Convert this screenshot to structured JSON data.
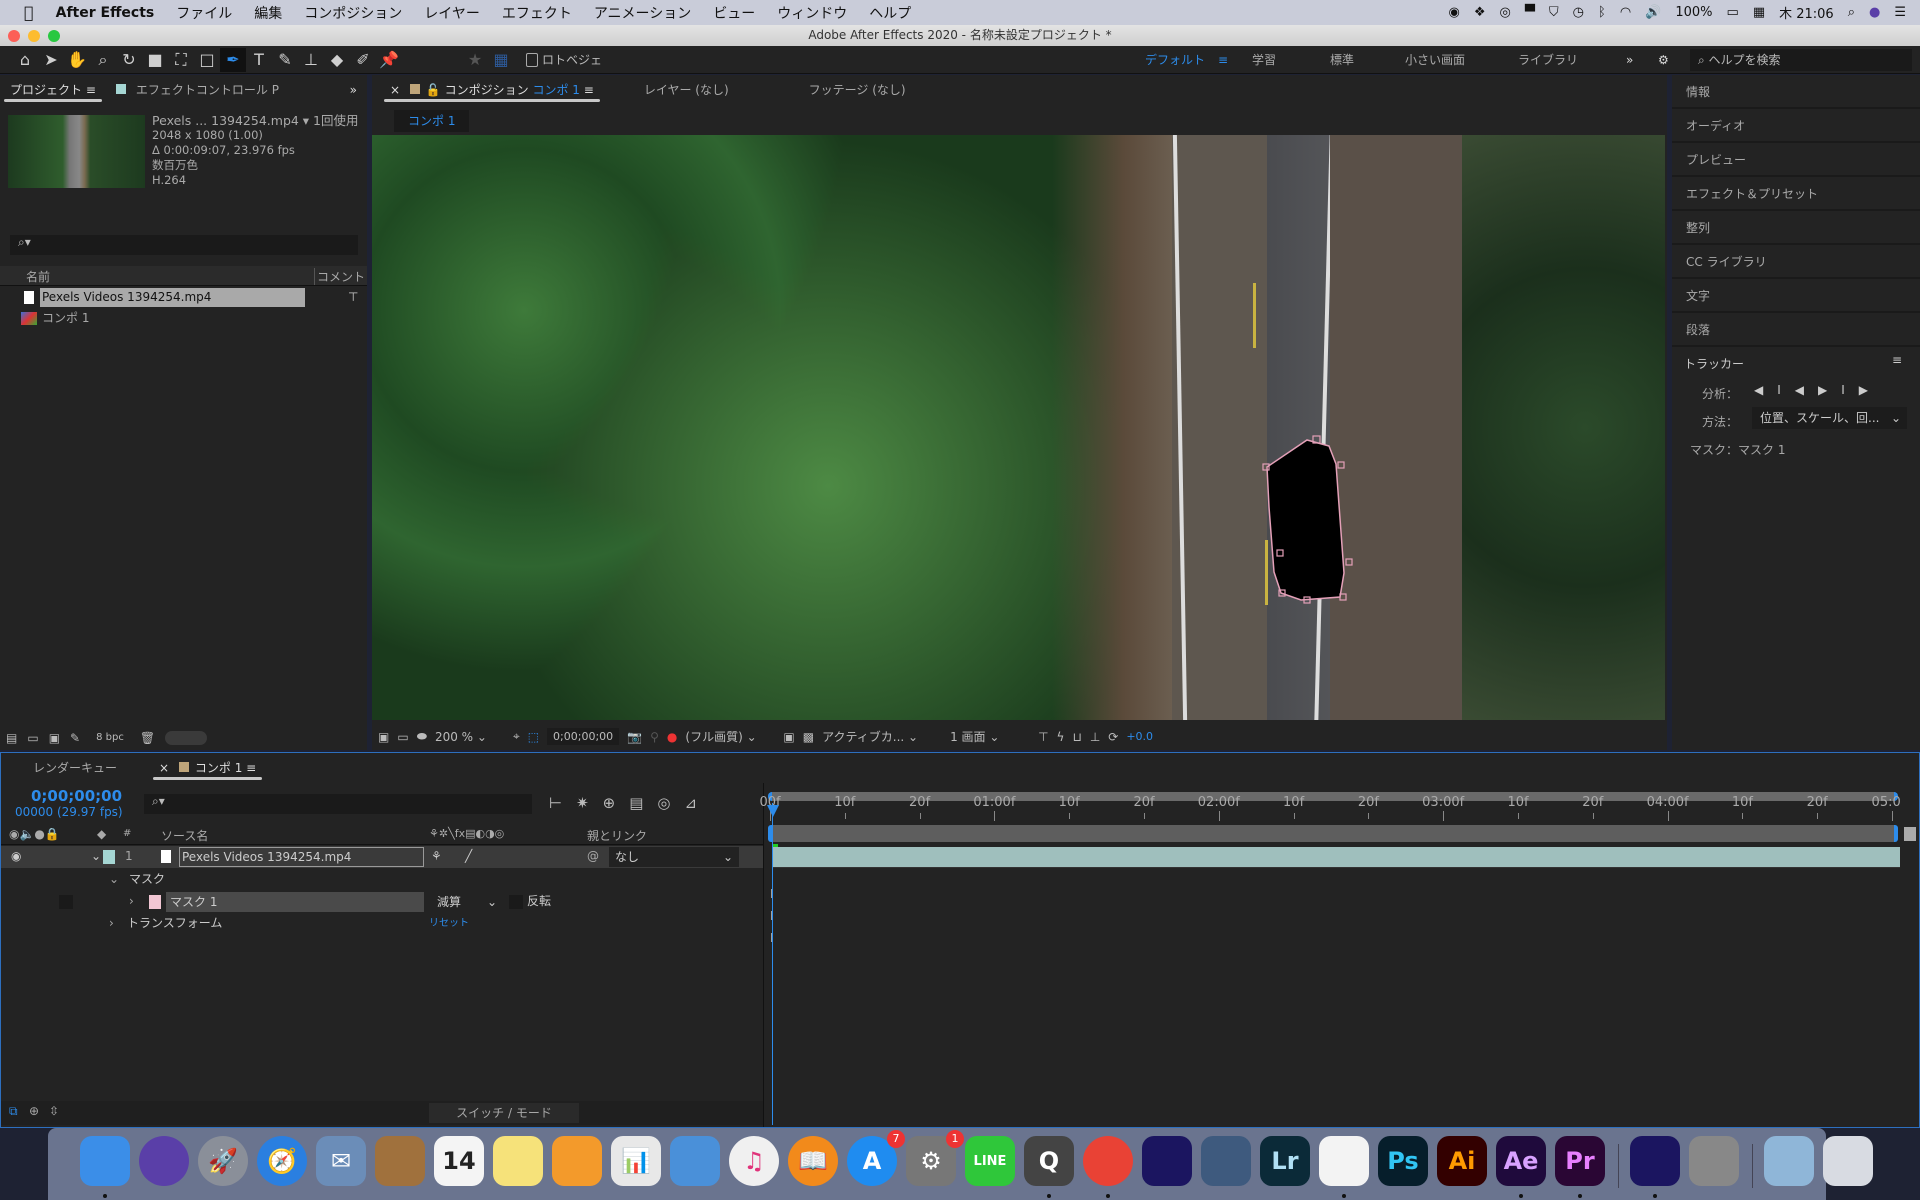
{
  "menubar": {
    "app": "After Effects",
    "items": [
      "ファイル",
      "編集",
      "コンポジション",
      "レイヤー",
      "エフェクト",
      "アニメーション",
      "ビュー",
      "ウィンドウ",
      "ヘルプ"
    ],
    "battery": "100%",
    "clock": "木 21:06"
  },
  "window": {
    "title": "Adobe After Effects 2020 - 名称未設定プロジェクト *"
  },
  "toolbar": {
    "rotobezier": "ロトベジェ",
    "workspaces": [
      "デフォルト",
      "学習",
      "標準",
      "小さい画面",
      "ライブラリ"
    ],
    "more": "»",
    "help_placeholder": "ヘルプを検索"
  },
  "project": {
    "tab_project": "プロジェクト",
    "tab_effects": "エフェクトコントロール P",
    "more": "»",
    "info": {
      "name": "Pexels ... 1394254.mp4 ▾ 1回使用",
      "res": "2048 x 1080 (1.00)",
      "duration": "Δ 0:00:09:07, 23.976 fps",
      "colors": "数百万色",
      "codec": "H.264"
    },
    "search_placeholder": "",
    "col_name": "名前",
    "col_comment": "コメント",
    "items": [
      "Pexels Videos 1394254.mp4",
      "コンポ 1"
    ],
    "bpc": "8 bpc"
  },
  "viewer": {
    "tab_comp_prefix": "コンポジション",
    "tab_comp_name": "コンポ 1",
    "tab_layer": "レイヤー (なし)",
    "tab_footage": "フッテージ (なし)",
    "breadcrumb": "コンポ 1",
    "zoom": "200 %",
    "timecode": "0;00;00;00",
    "quality": "(フル画質)",
    "camera": "アクティブカ...",
    "views": "1 画面",
    "exposure": "+0.0"
  },
  "right_panel": {
    "items": [
      "情報",
      "オーディオ",
      "プレビュー",
      "エフェクト＆プリセット",
      "整列",
      "CC ライブラリ",
      "文字",
      "段落"
    ],
    "tracker": {
      "title": "トラッカー",
      "analyze_label": "分析：",
      "method_label": "方法：",
      "method_value": "位置、スケール、回...",
      "mask_label": "マスク：マスク 1"
    }
  },
  "timeline": {
    "tab_render": "レンダーキュー",
    "tab_comp": "コンポ 1",
    "timecode": "0;00;00;00",
    "frames": "00000 (29.97 fps)",
    "col_hash": "#",
    "col_source": "ソース名",
    "col_parent": "親とリンク",
    "layer": {
      "num": "1",
      "name": "Pexels Videos 1394254.mp4",
      "parent": "なし"
    },
    "mask_group": "マスク",
    "mask": {
      "name": "マスク 1",
      "mode": "減算",
      "invert": "反転"
    },
    "transform": "トランスフォーム",
    "reset": "リセット",
    "switch_mode": "スイッチ / モード",
    "ruler": [
      "00f",
      "10f",
      "20f",
      "01:00f",
      "10f",
      "20f",
      "02:00f",
      "10f",
      "20f",
      "03:00f",
      "10f",
      "20f",
      "04:00f",
      "10f",
      "20f",
      "05:0"
    ],
    "bar_color": "#9fbfbd"
  },
  "dock": {
    "items": [
      {
        "name": "finder",
        "label": "",
        "color": "#3b8ee8",
        "dot": true
      },
      {
        "name": "siri",
        "label": "",
        "color": "#5a3fa8"
      },
      {
        "name": "launchpad",
        "label": "🚀",
        "color": "#8a8f99"
      },
      {
        "name": "safari",
        "label": "🧭",
        "color": "#2a7fe0"
      },
      {
        "name": "mail",
        "label": "✉",
        "color": "#6b8db8"
      },
      {
        "name": "contacts",
        "label": "",
        "color": "#a0713d"
      },
      {
        "name": "calendar",
        "label": "14",
        "color": "#f4f4f4",
        "text": "#222"
      },
      {
        "name": "notes",
        "label": "",
        "color": "#f6e27a"
      },
      {
        "name": "pages",
        "label": "",
        "color": "#f39a2b"
      },
      {
        "name": "numbers",
        "label": "📊",
        "color": "#e8e8e8"
      },
      {
        "name": "keynote",
        "label": "",
        "color": "#4a90d9"
      },
      {
        "name": "itunes",
        "label": "♫",
        "color": "#f0f0f0",
        "text": "#e0337a"
      },
      {
        "name": "books",
        "label": "📖",
        "color": "#f28a1b"
      },
      {
        "name": "app-store",
        "label": "A",
        "color": "#1f8cf0",
        "badge": "7"
      },
      {
        "name": "system-preferences",
        "label": "⚙",
        "color": "#777",
        "badge": "1"
      },
      {
        "name": "line",
        "label": "LINE",
        "color": "#2fc73a"
      },
      {
        "name": "quicktime",
        "label": "Q",
        "color": "#444",
        "dot": true
      },
      {
        "name": "chrome",
        "label": "",
        "color": "#e94235",
        "dot": true
      },
      {
        "name": "media-encoder",
        "label": "",
        "color": "#1b1560"
      },
      {
        "name": "bull-app",
        "label": "",
        "color": "#3e5a7e"
      },
      {
        "name": "lightroom",
        "label": "Lr",
        "color": "#0b2a38",
        "text": "#b1e0f5"
      },
      {
        "name": "textedit",
        "label": "",
        "color": "#f3f3f3",
        "dot": true
      },
      {
        "name": "photoshop",
        "label": "Ps",
        "color": "#061e2b",
        "text": "#31c5f4"
      },
      {
        "name": "illustrator",
        "label": "Ai",
        "color": "#330000",
        "text": "#ff9a00"
      },
      {
        "name": "after-effects",
        "label": "Ae",
        "color": "#1f0a3c",
        "text": "#d8a1ff",
        "dot": true
      },
      {
        "name": "premiere",
        "label": "Pr",
        "color": "#2a0634",
        "text": "#e880ff",
        "dot": true
      },
      {
        "name": "media-encoder-2",
        "label": "",
        "color": "#1b1560",
        "dot": true
      },
      {
        "name": "system-info",
        "label": "",
        "color": "#888"
      },
      {
        "name": "preview-images",
        "label": "",
        "color": "#8fb6d8"
      },
      {
        "name": "trash",
        "label": "",
        "color": "#d8dbe2"
      }
    ]
  }
}
